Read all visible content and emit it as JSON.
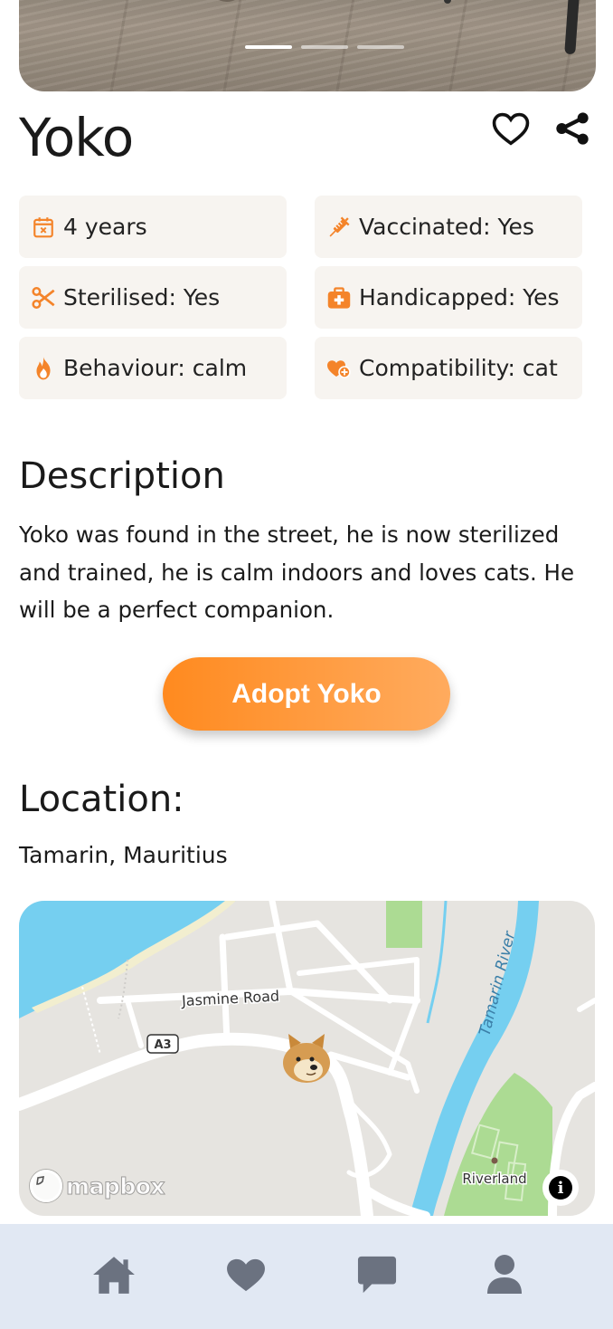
{
  "pet": {
    "name": "Yoko",
    "carousel": {
      "count": 3,
      "active_index": 0
    }
  },
  "chips": [
    {
      "label": "4 years",
      "icon": "calendar-icon"
    },
    {
      "label": "Vaccinated: Yes",
      "icon": "syringe-icon"
    },
    {
      "label": "Sterilised: Yes",
      "icon": "scissors-icon"
    },
    {
      "label": "Handicapped: Yes",
      "icon": "medical-kit-icon"
    },
    {
      "label": "Behaviour: calm",
      "icon": "flame-icon"
    },
    {
      "label": "Compatibility: cat",
      "icon": "heart-plus-icon"
    }
  ],
  "description": {
    "heading": "Description",
    "text": "Yoko was found in the street, he is now sterilized and trained, he is calm indoors and loves cats. He will be a perfect companion."
  },
  "adopt_button": {
    "label": "Adopt Yoko"
  },
  "location": {
    "heading": "Location:",
    "place": "Tamarin, Mauritius"
  },
  "map": {
    "labels": {
      "road": "Jasmine Road",
      "route": "A3",
      "river": "Tamarin River",
      "area": "Riverland"
    },
    "attribution": "mapbox",
    "info": "i"
  },
  "nav": {
    "items": [
      {
        "name": "home",
        "icon": "home-icon"
      },
      {
        "name": "favorites",
        "icon": "heart-icon"
      },
      {
        "name": "messages",
        "icon": "chat-icon"
      },
      {
        "name": "profile",
        "icon": "user-icon"
      }
    ]
  },
  "colors": {
    "accent": "#ff8a1f",
    "accent_light": "#ffab5e",
    "chip_bg": "#f7f4f0",
    "nav_bg": "#e1e8f3",
    "nav_icon": "#6b7280",
    "water": "#75cff0",
    "park": "#acdb93"
  }
}
